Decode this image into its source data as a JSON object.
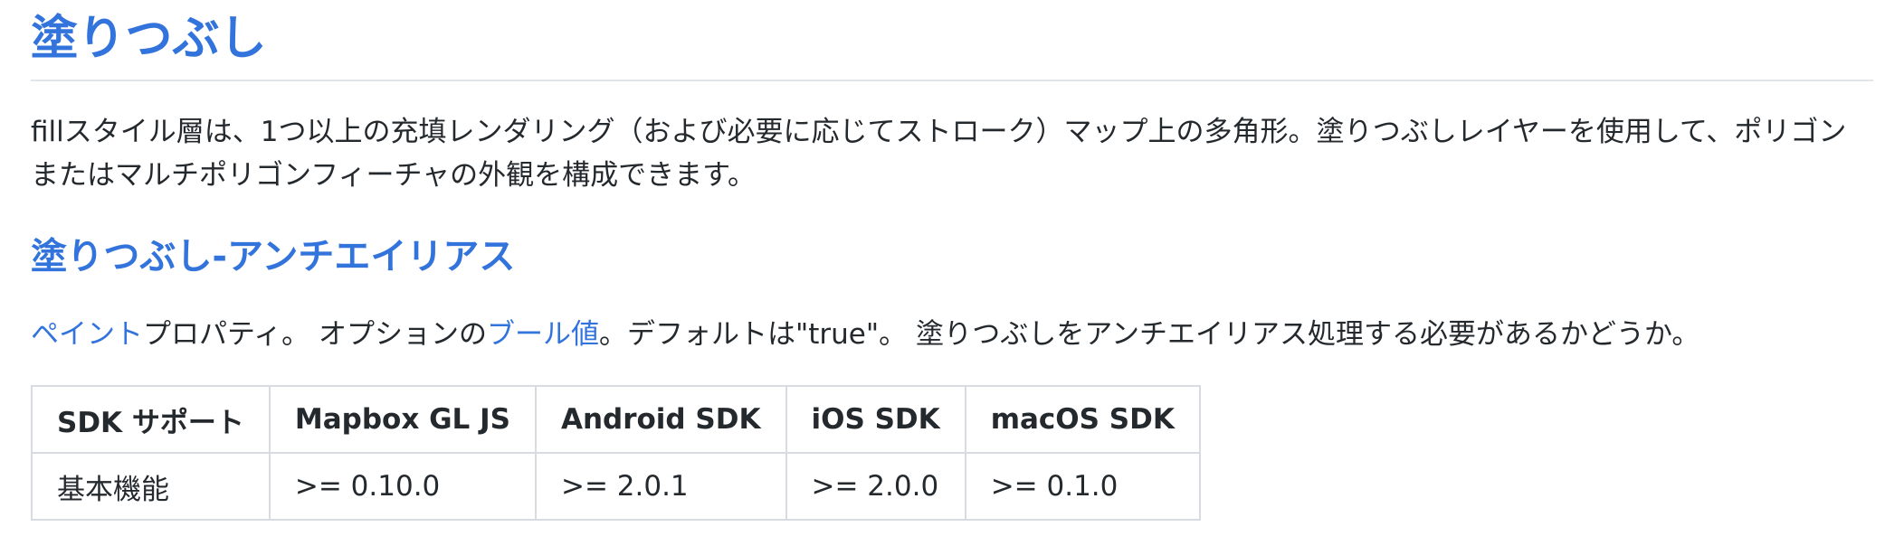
{
  "title": "塗りつぶし",
  "intro": "fillスタイル層は、1つ以上の充填レンダリング（および必要に応じてストローク）マップ上の多角形。塗りつぶしレイヤーを使用して、ポリゴンまたはマルチポリゴンフィーチャの外観を構成できます。",
  "section": {
    "heading": "塗りつぶし-アンチエイリアス",
    "link_paint": "ペイント",
    "text_property": "プロパティ。 オプションの",
    "link_boolean": "ブール値",
    "text_rest": "。デフォルトは\"true\"。 塗りつぶしをアンチエイリアス処理する必要があるかどうか。"
  },
  "table": {
    "headers": [
      "SDK サポート",
      "Mapbox GL JS",
      "Android SDK",
      "iOS SDK",
      "macOS SDK"
    ],
    "rows": [
      [
        "基本機能",
        ">= 0.10.0",
        ">= 2.0.1",
        ">= 2.0.0",
        ">= 0.1.0"
      ]
    ]
  },
  "colors": {
    "heading": "#3273dc",
    "link": "#3273dc",
    "text": "#24292e",
    "rule": "#e1e4e8",
    "table_border": "#d8dce2"
  }
}
